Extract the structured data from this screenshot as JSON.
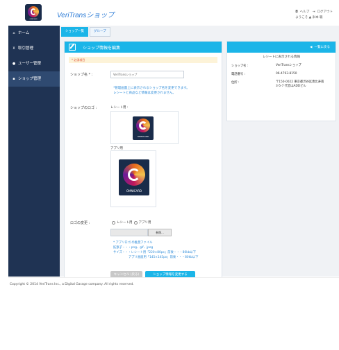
{
  "app": {
    "title": "VeriTransショップ",
    "logo_text": "OMNICARD"
  },
  "header": {
    "help": "ヘルプ",
    "logout": "ログアウト",
    "welcome": "ようこそ ▲ 米本 聡"
  },
  "sidebar": {
    "items": [
      {
        "icon": "home-icon",
        "label": "ホーム"
      },
      {
        "icon": "cart-icon",
        "label": "取引管理"
      },
      {
        "icon": "user-icon",
        "label": "ユーザー管理"
      },
      {
        "icon": "shop-icon",
        "label": "ショップ管理"
      }
    ]
  },
  "tabs": {
    "shop_list": "ショップ一覧",
    "group": "グループ"
  },
  "panel": {
    "title": "ショップ情報を編集",
    "required_note": "* 必須項目",
    "shop_name_label": "ショップ名 * :",
    "shop_name_value": "VeriTransショップ",
    "shop_name_help_1": "*管理画面上に表示されるショップ名を変更できます。",
    "shop_name_help_2": "レシートと商品など情報は変更されません。",
    "logo_label": "ショップのロゴ :",
    "receipt_label": "レシート用 :",
    "app_label": "アプリ用",
    "logo_change_label": "ロゴの変更 :",
    "radio_receipt": "レシート用",
    "radio_app": "アプリ用",
    "browse": "参照...",
    "note_1": "* アプリロゴ の推奨ファイル",
    "note_2": "拡張子・・・png、gif、jpeg",
    "note_3": "サイズ・・・レシート用「220×80px」前後・・・80kb以下",
    "note_4": "アプリ画面用「145×145px」前後・・・80kb以下",
    "cancel": "キャンセル (戻る)",
    "submit": "ショップ情報を変更する"
  },
  "side": {
    "back": "一覧に戻る",
    "receipt_title": "レシートに表示される情報",
    "rows": [
      {
        "label": "ショップ名 :",
        "value": "VeriTransショップ"
      },
      {
        "label": "電話番号 :",
        "value": "06-4793-8150"
      },
      {
        "label": "住所 :",
        "value": "〒150-0022 東京都渋谷区恵比寿南"
      }
    ],
    "address_line_2": "3-5-7 代官山ADDビル"
  },
  "footer": {
    "copyright": "Copyright © 2014 VeriTrans Inc., a Digital Garage company. All rights reserved."
  },
  "colors": {
    "accent": "#1bb5e8",
    "sidebar": "#1f3353",
    "link": "#2b8ad8"
  }
}
